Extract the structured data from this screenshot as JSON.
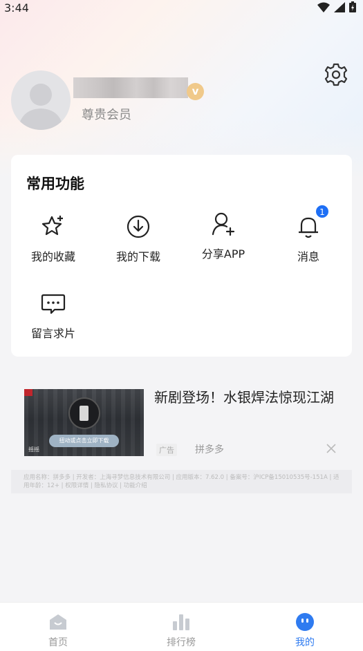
{
  "status_bar": {
    "time": "3:44"
  },
  "profile": {
    "member_level": "尊贵会员",
    "vip_badge": "v"
  },
  "functions": {
    "title": "常用功能",
    "items": [
      {
        "label": "我的收藏",
        "icon": "star-plus-icon"
      },
      {
        "label": "我的下载",
        "icon": "download-icon"
      },
      {
        "label": "分享APP",
        "icon": "user-add-icon"
      },
      {
        "label": "消息",
        "icon": "bell-icon",
        "badge": "1"
      },
      {
        "label": "留言求片",
        "icon": "chat-icon"
      }
    ]
  },
  "ad": {
    "title": "新剧登场！水银焊法惊现江湖",
    "tag": "广告",
    "advertiser": "拼多多",
    "thumb_cta": "扭动或点击立即下载",
    "thumb_shake": "摇摇",
    "disclosure": "应用名称：拼多多 | 开发者：上海寻梦信息技术有限公司 | 应用版本：7.62.0 | 备案号：沪ICP备15010535号-151A | 适用年龄：12+ | 权限详情 | 隐私协议 | 功能介绍"
  },
  "bottom_nav": {
    "items": [
      {
        "label": "首页",
        "icon": "home-icon"
      },
      {
        "label": "排行榜",
        "icon": "ranking-icon"
      },
      {
        "label": "我的",
        "icon": "mine-icon"
      }
    ],
    "active_index": 2
  },
  "colors": {
    "accent": "#2f7bf0",
    "badge": "#1e6ff5",
    "vip": "#f0c98a"
  }
}
